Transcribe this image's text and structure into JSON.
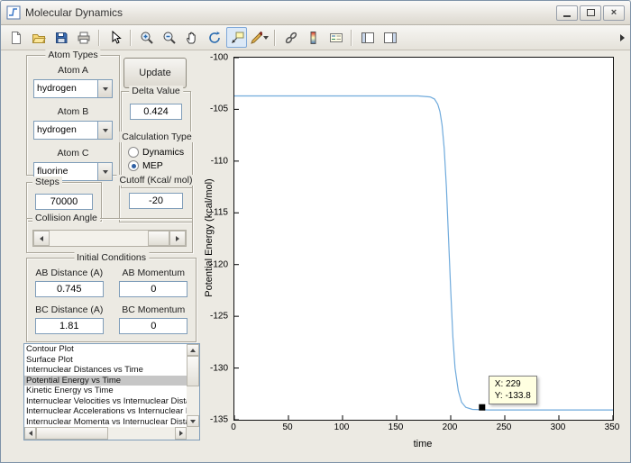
{
  "window": {
    "title": "Molecular Dynamics",
    "controls": {
      "close_glyph": "×"
    }
  },
  "toolbar": {
    "icons": [
      "new-file",
      "open-folder",
      "save",
      "print",
      "cursor",
      "zoom-in",
      "zoom-out",
      "pan-hand",
      "rotate-3d",
      "data-cursor",
      "brush",
      "link-plot",
      "insert-colorbar",
      "insert-legend",
      "hide-plot-tools",
      "show-plot-tools"
    ],
    "active_icon": "data-cursor"
  },
  "panels": {
    "atom_types": {
      "title": "Atom Types",
      "fields": [
        {
          "label": "Atom A",
          "value": "hydrogen"
        },
        {
          "label": "Atom B",
          "value": "hydrogen"
        },
        {
          "label": "Atom C",
          "value": "fluorine"
        }
      ]
    },
    "update_button": "Update",
    "delta": {
      "title": "Delta Value",
      "value": "0.424"
    },
    "calculation": {
      "title": "Calculation Type",
      "options": [
        {
          "label": "Dynamics",
          "selected": false
        },
        {
          "label": "MEP",
          "selected": true
        }
      ]
    },
    "steps": {
      "title": "Steps",
      "value": "70000"
    },
    "cutoff": {
      "title": "Cutoff (Kcal/ mol)",
      "value": "-20"
    },
    "collision": {
      "title": "Collision Angle"
    },
    "initial_conditions": {
      "title": "Initial Conditions",
      "fields": [
        {
          "label": "AB Distance (A)",
          "value": "0.745"
        },
        {
          "label": "AB Momentum",
          "value": "0"
        },
        {
          "label": "BC Distance (A)",
          "value": "1.81"
        },
        {
          "label": "BC Momentum",
          "value": "0"
        }
      ]
    },
    "plot_list": {
      "items": [
        "Contour Plot",
        "Surface Plot",
        "Internuclear Distances vs Time",
        "Potential Energy vs Time",
        "Kinetic Energy vs Time",
        "Internuclear Velocities vs Internuclear Distance",
        "Internuclear Accelerations vs Internuclear Dista",
        "Internuclear Momenta vs Internuclear Distance"
      ],
      "selected_index": 3
    }
  },
  "colors": {
    "plot_line": "#6FAADC",
    "datatip_bg": "#FFFFE1",
    "list_selection": "#C6C6C6",
    "radio_accent": "#2E5FA3"
  },
  "chart_data": {
    "type": "line",
    "title": "",
    "xlabel": "time",
    "ylabel": "Potential Energy (kcal/mol)",
    "xlim": [
      0,
      350
    ],
    "ylim": [
      -135,
      -100
    ],
    "xticks": [
      0,
      50,
      100,
      150,
      200,
      250,
      300,
      350
    ],
    "yticks": [
      -135,
      -130,
      -125,
      -120,
      -115,
      -110,
      -105,
      -100
    ],
    "grid": false,
    "legend": "none",
    "line_color": "#6FAADC",
    "series": [
      {
        "name": "potential-energy",
        "x": [
          0,
          30,
          80,
          130,
          170,
          181,
          185,
          188,
          190,
          192,
          194,
          196,
          198,
          200,
          202,
          204,
          207,
          210,
          214,
          220,
          235,
          260,
          300,
          350
        ],
        "y": [
          -103.7,
          -103.7,
          -103.7,
          -103.7,
          -103.7,
          -103.8,
          -104.0,
          -104.5,
          -105.2,
          -106.5,
          -108.8,
          -112.5,
          -117.5,
          -122.5,
          -127.0,
          -130.0,
          -132.2,
          -133.3,
          -133.8,
          -134.0,
          -134.05,
          -134.05,
          -134.05,
          -134.05
        ]
      }
    ],
    "datatip": {
      "x": 229,
      "y": -133.8,
      "label_x": "X: 229",
      "label_y": "Y: -133.8"
    }
  }
}
